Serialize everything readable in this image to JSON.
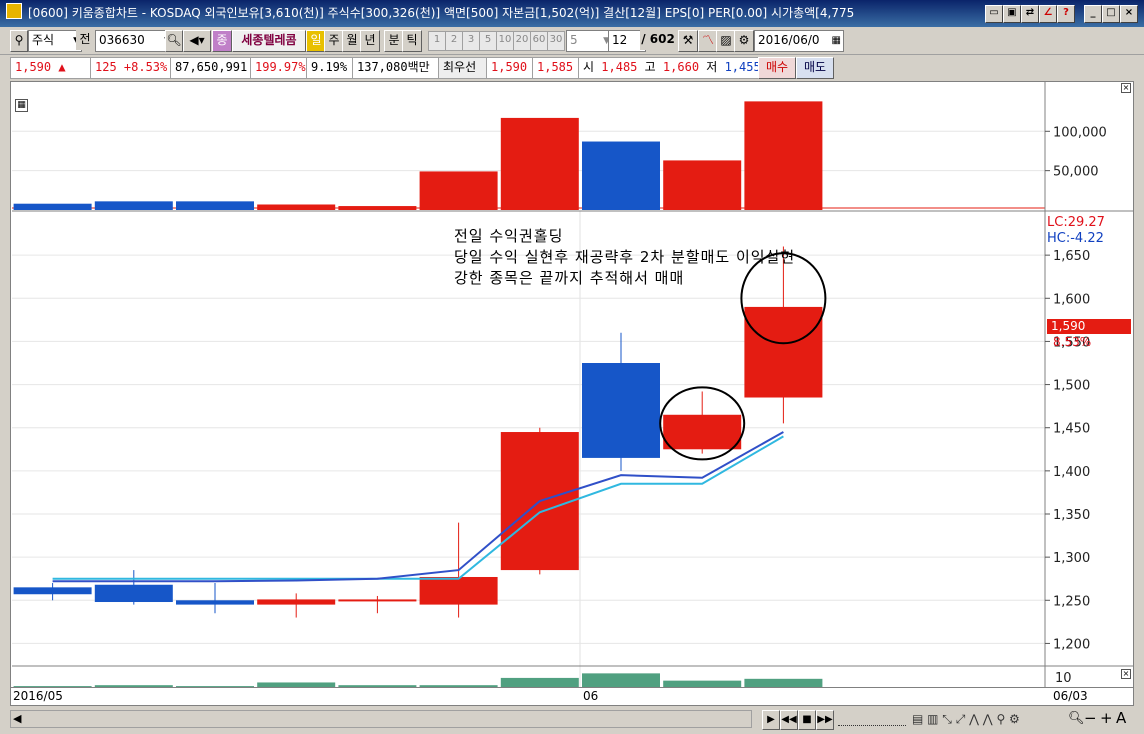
{
  "window": {
    "title": "[0600] 키움종합차트 - KOSDAQ 외국인보유[3,610(천)] 주식수[300,326(천)] 액면[500] 자본금[1,502(억)] 결산[12월] EPS[0] PER[0.00] 시가총액[4,775"
  },
  "toolbar": {
    "market": "주식",
    "code": "036630",
    "name": "세종텔레콤",
    "period_active": "일",
    "periods": [
      "주",
      "월",
      "년",
      "분",
      "틱"
    ],
    "minute_tabs": [
      "1",
      "2",
      "3",
      "5",
      "10",
      "20",
      "60",
      "30"
    ],
    "interval_value": "5",
    "count_value": "12",
    "count_total": "/ 602",
    "date": "2016/06/0",
    "prev_label": "전",
    "sel_label": "종"
  },
  "quote": {
    "price": "1,590 ▲",
    "change": "125 +8.53%",
    "volume": "87,650,991",
    "vol_ratio": "199.97%",
    "turnover": "9.19%",
    "amount": "137,080백만",
    "best_label": "최우선",
    "ask": "1,590",
    "bid": "1,585",
    "open_label": "시",
    "open": "1,485",
    "high_label": "고",
    "high": "1,660",
    "low_label": "저",
    "low": "1,455",
    "buy": "매수",
    "sell": "매도"
  },
  "annotations": [
    "전일 수익권홀딩",
    "당일 수익 실현후 재공략후 2차 분할매도 이익실현",
    "강한 종목은 끝까지 추적해서 매매"
  ],
  "price_axis": {
    "lc": "LC:29.27",
    "hc": "HC:-4.22",
    "current_label": "1,590",
    "current_pct": "8.53%"
  },
  "x_axis": {
    "left": "2016/05",
    "mid": "06",
    "right": "06/03"
  },
  "colors": {
    "up": "#e41c12",
    "down": "#1656c8",
    "ma1": "#3050c8",
    "ma2": "#30b8e0",
    "vol": "#50a080"
  },
  "chart_data": [
    {
      "type": "candlestick",
      "ylim": [
        1175,
        1700
      ],
      "yticks": [
        1200,
        1250,
        1300,
        1350,
        1400,
        1450,
        1500,
        1550,
        1600,
        1650
      ],
      "candles": [
        {
          "o": 1265,
          "h": 1270,
          "l": 1250,
          "c": 1257
        },
        {
          "o": 1268,
          "h": 1285,
          "l": 1245,
          "c": 1248
        },
        {
          "o": 1250,
          "h": 1270,
          "l": 1235,
          "c": 1245
        },
        {
          "o": 1245,
          "h": 1258,
          "l": 1230,
          "c": 1251
        },
        {
          "o": 1250,
          "h": 1255,
          "l": 1235,
          "c": 1251
        },
        {
          "o": 1245,
          "h": 1340,
          "l": 1230,
          "c": 1277
        },
        {
          "o": 1285,
          "h": 1450,
          "l": 1280,
          "c": 1445
        },
        {
          "o": 1525,
          "h": 1560,
          "l": 1400,
          "c": 1415
        },
        {
          "o": 1425,
          "h": 1492,
          "l": 1420,
          "c": 1465
        },
        {
          "o": 1485,
          "h": 1660,
          "l": 1455,
          "c": 1590
        }
      ],
      "ma_fast": [
        1272,
        1272,
        1272,
        1273,
        1275,
        1285,
        1365,
        1395,
        1392,
        1445
      ],
      "ma_slow": [
        1275,
        1275,
        1275,
        1275,
        1275,
        1275,
        1352,
        1385,
        1385,
        1440
      ]
    },
    {
      "type": "bar",
      "name": "foreign_net",
      "yticks": [
        50000,
        100000
      ],
      "ylim": [
        0,
        155000
      ],
      "values": [
        8000,
        11000,
        11000,
        7000,
        5000,
        49000,
        117000,
        87000,
        63000,
        138000
      ],
      "up": [
        false,
        false,
        false,
        true,
        true,
        true,
        true,
        false,
        true,
        true
      ]
    },
    {
      "type": "bar",
      "name": "volume",
      "ytick": "10",
      "ylim": [
        0,
        22
      ],
      "values": [
        1,
        2,
        1,
        5,
        2,
        2,
        10,
        15,
        7,
        9
      ]
    }
  ]
}
